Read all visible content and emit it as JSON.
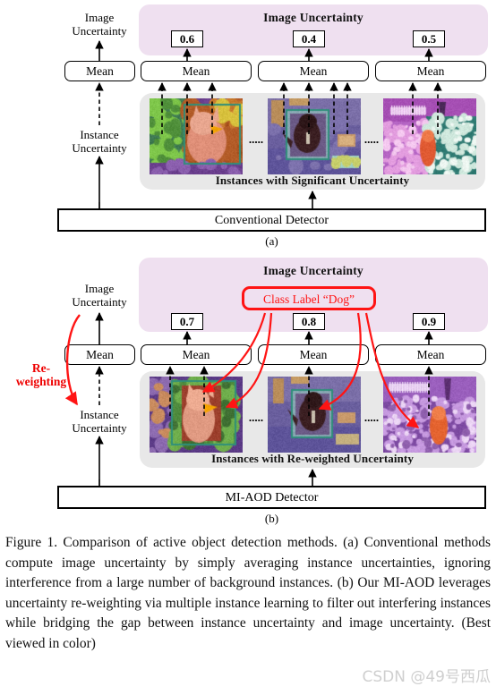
{
  "figure": {
    "caption": "Figure 1. Comparison of active object detection methods. (a) Conventional methods compute image uncertainty by simply averaging instance uncertainties, ignoring interference from a large number of background instances. (b) Our MI-AOD leverages uncertainty re-weighting via multiple instance learning to filter out interfering instances while bridging the gap between instance uncertainty and image uncertainty. (Best viewed in color)",
    "watermark": "CSDN @49号西瓜"
  },
  "panel_a": {
    "label": "(a)",
    "image_uncertainty_title": "Image Uncertainty",
    "instances_title": "Instances with Significant Uncertainty",
    "detector_label": "Conventional Detector",
    "side_top_label": "Image\nUncertainty",
    "side_bottom_label": "Instance\nUncertainty",
    "mean_label": "Mean",
    "ellipsis": ".....",
    "values": [
      "0.6",
      "0.4",
      "0.5"
    ],
    "means": [
      "Mean",
      "Mean",
      "Mean",
      "Mean"
    ]
  },
  "panel_b": {
    "label": "(b)",
    "image_uncertainty_title": "Image Uncertainty",
    "instances_title": "Instances with Re-weighted Uncertainty",
    "detector_label": "MI-AOD Detector",
    "side_top_label": "Image\nUncertainty",
    "side_bottom_label": "Instance\nUncertainty",
    "reweighting_label": "Re-\nweighting",
    "class_label": "Class Label “Dog”",
    "mean_label": "Mean",
    "ellipsis": ".....",
    "values": [
      "0.7",
      "0.8",
      "0.9"
    ],
    "means": [
      "Mean",
      "Mean",
      "Mean",
      "Mean"
    ]
  },
  "colors": {
    "lavender_panel": "#efe0f0",
    "gray_panel": "#e8e8e8",
    "red_accent": "#ff1414",
    "outline": "#000000"
  }
}
